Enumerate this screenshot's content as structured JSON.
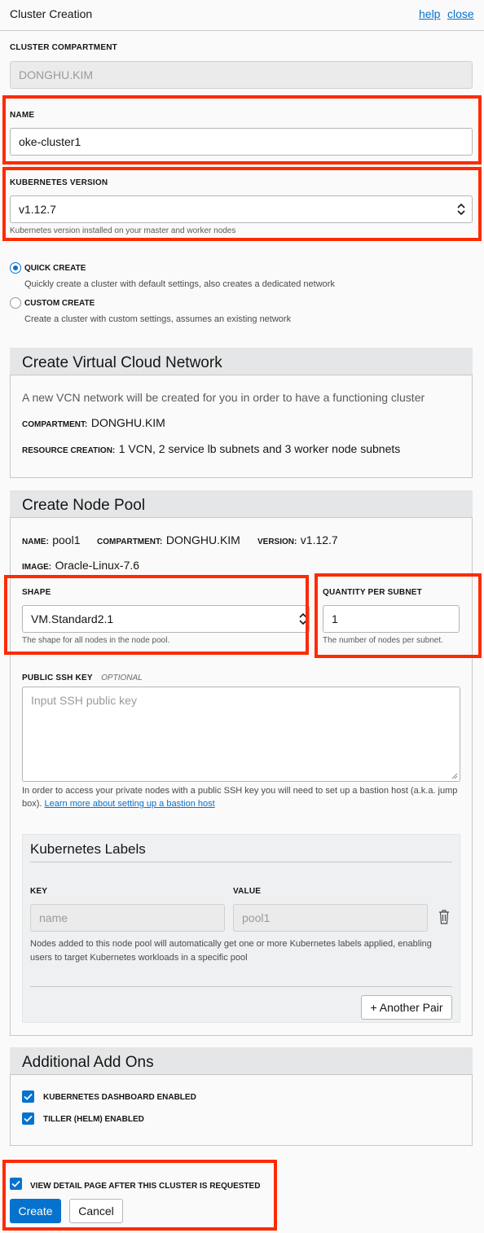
{
  "header": {
    "title": "Cluster Creation",
    "help": "help",
    "close": "close"
  },
  "compartment": {
    "label": "CLUSTER COMPARTMENT",
    "value": "DONGHU.KIM"
  },
  "name": {
    "label": "NAME",
    "value": "oke-cluster1"
  },
  "k8s_version": {
    "label": "KUBERNETES VERSION",
    "value": "v1.12.7",
    "hint": "Kubernetes version installed on your master and worker nodes"
  },
  "create_mode": {
    "quick": {
      "label": "QUICK CREATE",
      "desc": "Quickly create a cluster with default settings, also creates a dedicated network",
      "selected": true
    },
    "custom": {
      "label": "CUSTOM CREATE",
      "desc": "Create a cluster with custom settings, assumes an existing network",
      "selected": false
    }
  },
  "vcn": {
    "title": "Create Virtual Cloud Network",
    "intro": "A new VCN network will be created for you in order to have a functioning cluster",
    "compartment_label": "COMPARTMENT:",
    "compartment_value": "DONGHU.KIM",
    "resource_label": "RESOURCE CREATION:",
    "resource_value": "1 VCN, 2 service lb subnets and 3 worker node subnets"
  },
  "node_pool": {
    "title": "Create Node Pool",
    "name_label": "NAME:",
    "name_value": "pool1",
    "compartment_label": "COMPARTMENT:",
    "compartment_value": "DONGHU.KIM",
    "version_label": "VERSION:",
    "version_value": "v1.12.7",
    "image_label": "IMAGE:",
    "image_value": "Oracle-Linux-7.6",
    "shape": {
      "label": "SHAPE",
      "value": "VM.Standard2.1",
      "hint": "The shape for all nodes in the node pool."
    },
    "quantity": {
      "label": "QUANTITY PER SUBNET",
      "value": "1",
      "hint": "The number of nodes per subnet."
    },
    "ssh": {
      "label": "PUBLIC SSH KEY",
      "optional": "OPTIONAL",
      "placeholder": "Input SSH public key",
      "help": "In order to access your private nodes with a public SSH key you will need to set up a bastion host (a.k.a. jump box).",
      "link": "Learn more about setting up a bastion host"
    },
    "labels": {
      "title": "Kubernetes Labels",
      "key_header": "KEY",
      "value_header": "VALUE",
      "key_value": "name",
      "value_value": "pool1",
      "help": "Nodes added to this node pool will automatically get one or more Kubernetes labels applied, enabling users to target Kubernetes workloads in a specific pool",
      "add_pair": "+ Another Pair"
    }
  },
  "addons": {
    "title": "Additional Add Ons",
    "dashboard": {
      "label": "KUBERNETES DASHBOARD ENABLED",
      "checked": true
    },
    "tiller": {
      "label": "TILLER (HELM) ENABLED",
      "checked": true
    }
  },
  "footer": {
    "view_detail": {
      "label": "VIEW DETAIL PAGE AFTER THIS CLUSTER IS REQUESTED",
      "checked": true
    },
    "create": "Create",
    "cancel": "Cancel"
  },
  "colors": {
    "accent": "#0572ce",
    "highlight": "#ff2a00",
    "panel_header": "#e4e6e8"
  }
}
